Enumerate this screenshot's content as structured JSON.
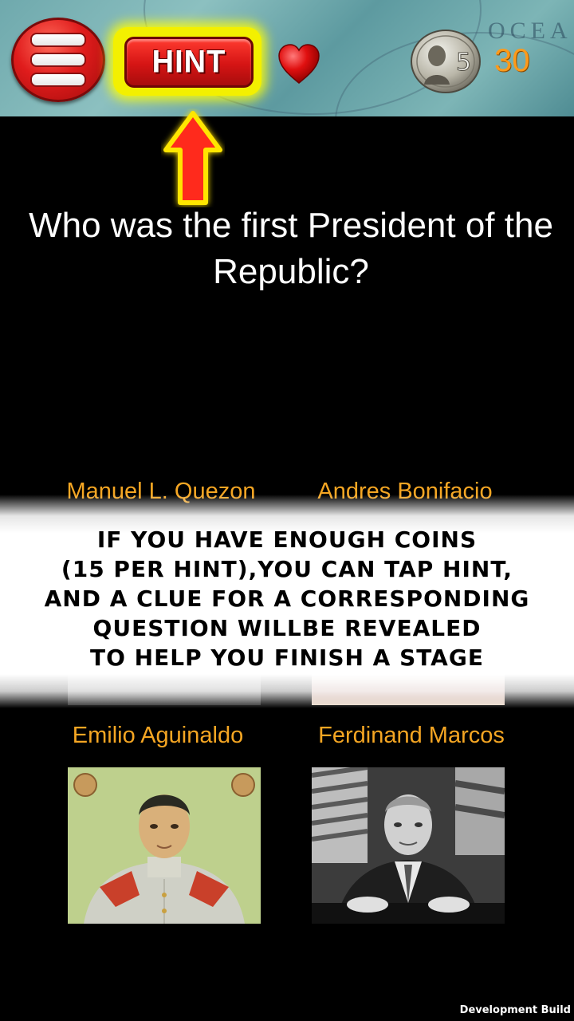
{
  "header": {
    "hint_label": "HINT",
    "coin_value": "5",
    "coin_count": "30"
  },
  "question": {
    "text": "Who was the first President of the Republic?"
  },
  "answers": [
    {
      "label": "Manuel L. Quezon"
    },
    {
      "label": "Andres Bonifacio"
    },
    {
      "label": "Emilio Aguinaldo"
    },
    {
      "label": "Ferdinand Marcos"
    }
  ],
  "tutorial": {
    "lines": [
      "IF YOU HAVE ENOUGH COINS",
      "(15 PER HINT),YOU CAN TAP HINT,",
      "AND A CLUE FOR A CORRESPONDING",
      "QUESTION WILLBE REVEALED",
      "TO HELP YOU FINISH A STAGE"
    ]
  },
  "footer": {
    "build_label": "Development Build"
  },
  "colors": {
    "answer_text": "#f5a623",
    "coin_text": "#ff9a1a",
    "hint_button": "#d51414",
    "hint_glow": "#f3f000"
  }
}
